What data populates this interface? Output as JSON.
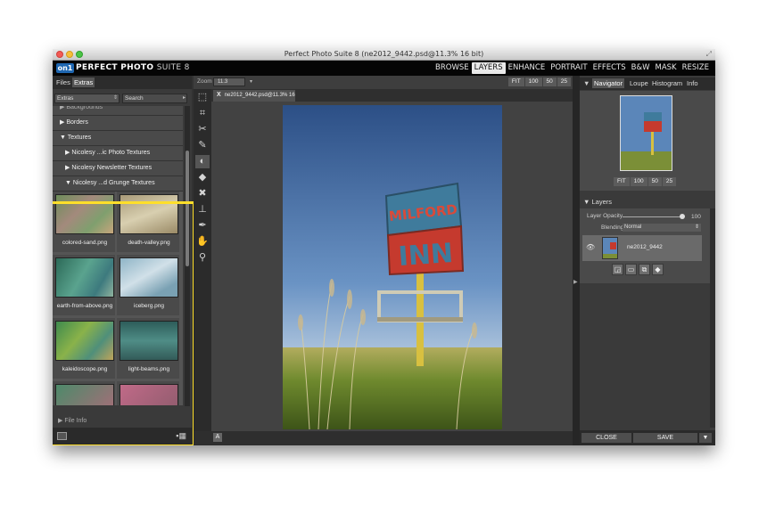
{
  "window": {
    "title": "Perfect Photo Suite 8 (ne2012_9442.psd@11.3% 16 bit)"
  },
  "brand": {
    "logo_mark": "on1",
    "name_bold": "PERFECT PHOTO",
    "name_light": "SUITE 8"
  },
  "modules": [
    {
      "label": "BROWSE"
    },
    {
      "label": "LAYERS",
      "active": true
    },
    {
      "label": "ENHANCE"
    },
    {
      "label": "PORTRAIT"
    },
    {
      "label": "EFFECTS"
    },
    {
      "label": "B&W"
    },
    {
      "label": "MASK"
    },
    {
      "label": "RESIZE"
    }
  ],
  "left_panel": {
    "tabs": [
      "Files",
      "Extras"
    ],
    "filter_value": "Extras",
    "search_placeholder": "Search",
    "tree": [
      {
        "label": "▶ Backgrounds"
      },
      {
        "label": "▶ Borders"
      },
      {
        "label": "▼ Textures"
      },
      {
        "label": "▶ Nicolesy ...ic Photo Textures"
      },
      {
        "label": "▶ Nicolesy Newsletter Textures"
      },
      {
        "label": "▼ Nicolesy ...d Grunge Textures"
      }
    ],
    "thumbnails": [
      {
        "label": "colored-sand.png"
      },
      {
        "label": "death-valley.png"
      },
      {
        "label": "earth-from-above.png"
      },
      {
        "label": "iceberg.png"
      },
      {
        "label": "kaleidoscope.png"
      },
      {
        "label": "light-beams.png"
      }
    ],
    "file_info_label": "▶ File Info"
  },
  "toolbar_icons": [
    "transform-icon",
    "crop-icon",
    "cut-icon",
    "brush-icon",
    "mask-icon",
    "eraser-icon",
    "retouch-icon",
    "stamp-icon",
    "magic-brush-icon",
    "hand-icon",
    "zoom-icon"
  ],
  "canvas": {
    "zoom_label": "Zoom",
    "zoom_value": "11.3",
    "zoom_buttons": [
      "FIT",
      "100",
      "50",
      "25"
    ],
    "doc_tab_close": "X",
    "doc_tab_name": "ne2012_9442.psd@11.3% 16 bit",
    "bottom_label": "A",
    "sign_top": "MILFORD",
    "sign_bottom": "INN"
  },
  "right_panel": {
    "tabs": [
      "Navigator",
      "Loupe",
      "Histogram",
      "Info"
    ],
    "nav_buttons": [
      "FIT",
      "100",
      "50",
      "25"
    ],
    "layers_title": "▼ Layers",
    "layer_opacity_label": "Layer Opacity",
    "layer_opacity_value": "100",
    "blending_label": "Blending",
    "blending_value": "Normal",
    "layer_name": "ne2012_9442",
    "close_label": "CLOSE",
    "save_label": "SAVE",
    "save_arrow": "▼"
  },
  "colors": {
    "accent_highlight": "#ffdf2a",
    "logo_blue": "#1f67b1",
    "panel_bg": "#3a3a3a"
  }
}
